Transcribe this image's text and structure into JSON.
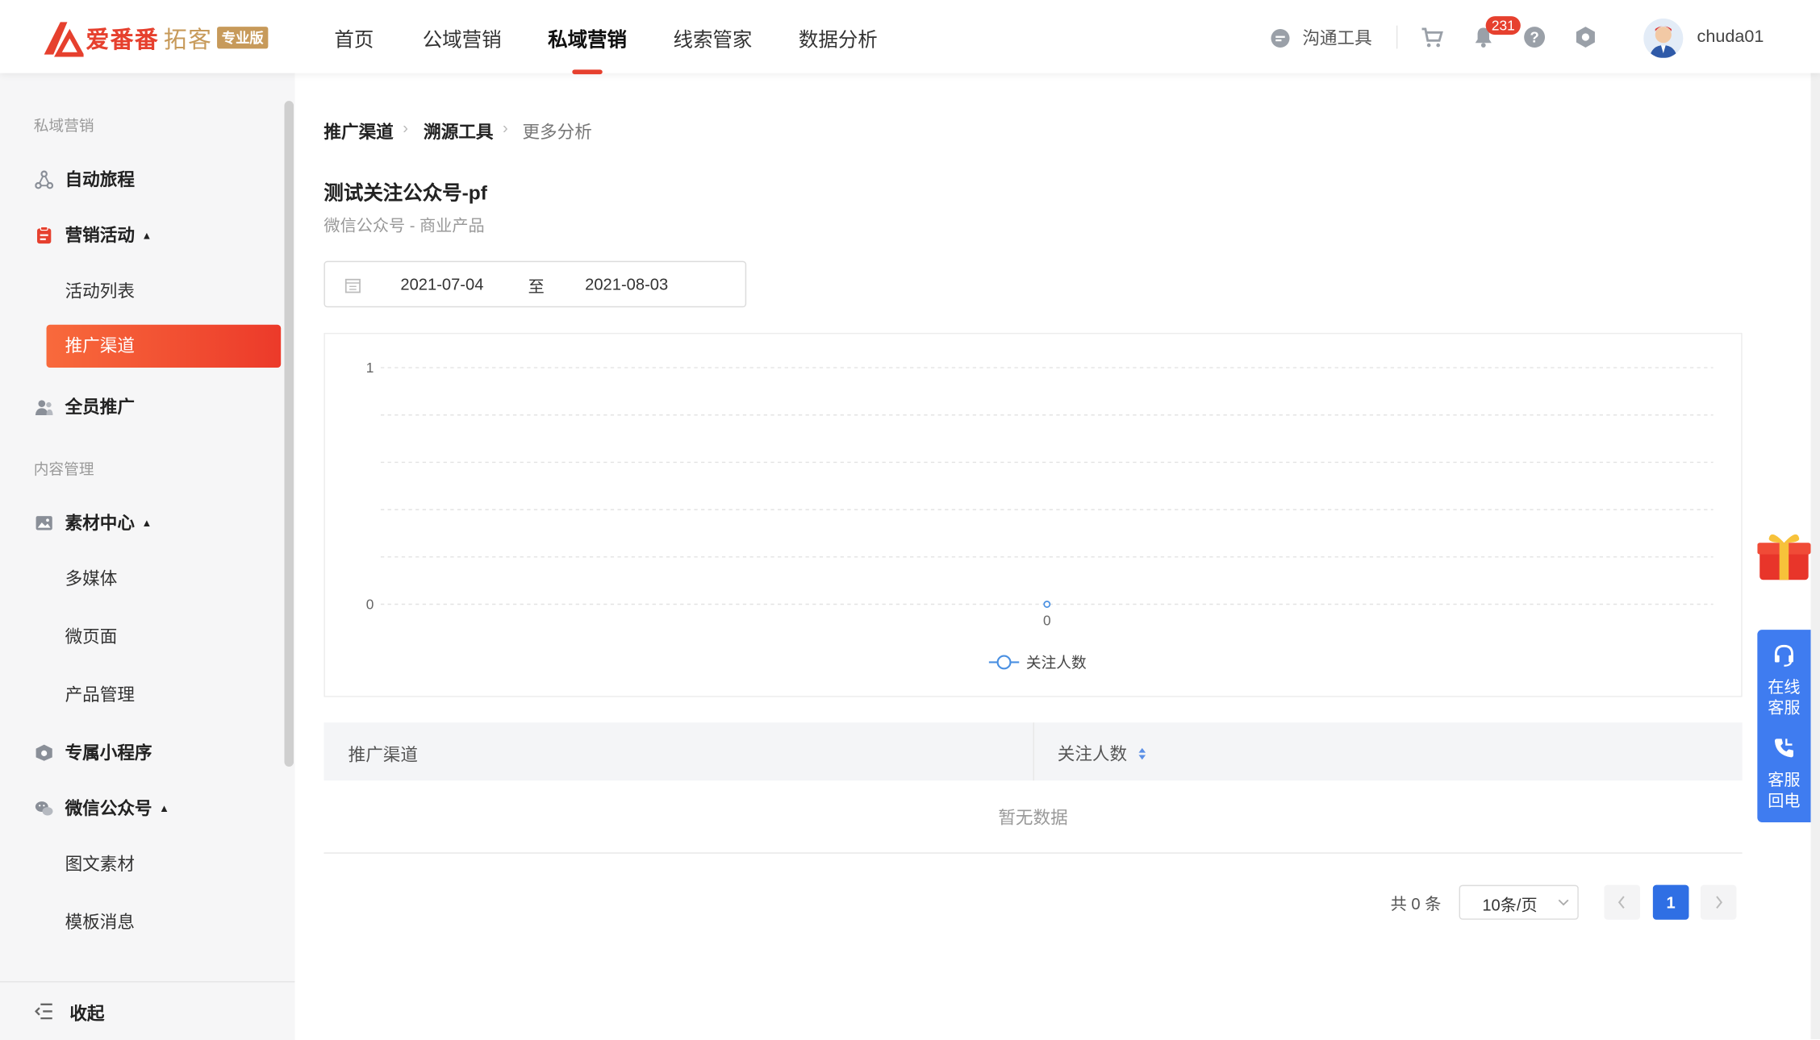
{
  "header": {
    "brand": "爱番番",
    "brand_suffix": "拓客",
    "edition": "专业版",
    "nav": [
      "首页",
      "公域营销",
      "私域营销",
      "线索管家",
      "数据分析"
    ],
    "active_nav": "私域营销",
    "comm_tool": "沟通工具",
    "notification_count": "231",
    "username": "chuda01"
  },
  "sidebar": {
    "group1": "私域营销",
    "auto_journey": "自动旅程",
    "marketing_activity": "营销活动",
    "activity_list": "活动列表",
    "promo_channel": "推广渠道",
    "all_staff_promo": "全员推广",
    "group2": "内容管理",
    "material_center": "素材中心",
    "multimedia": "多媒体",
    "micro_page": "微页面",
    "product_mgmt": "产品管理",
    "mini_program": "专属小程序",
    "wechat_oa": "微信公众号",
    "article_material": "图文素材",
    "template_msg": "模板消息",
    "collapse": "收起"
  },
  "breadcrumb": [
    "推广渠道",
    "溯源工具",
    "更多分析"
  ],
  "page": {
    "title": "测试关注公众号-pf",
    "subtitle": "微信公众号 - 商业产品",
    "date_start": "2021-07-04",
    "date_sep": "至",
    "date_end": "2021-08-03"
  },
  "chart_data": {
    "type": "line",
    "series": [
      {
        "name": "关注人数",
        "values": [
          0
        ]
      }
    ],
    "x": [
      "0"
    ],
    "ylim": [
      0,
      1
    ],
    "yticks": [
      "0",
      "1"
    ],
    "grid": true,
    "legend": "bottom-center",
    "color": "#4a90e2"
  },
  "table": {
    "columns": [
      "推广渠道",
      "关注人数"
    ],
    "empty_text": "暂无数据"
  },
  "pagination": {
    "total": "共 0 条",
    "page_size": "10条/页",
    "current_page": "1"
  },
  "float_panel": {
    "online_service": "在线客服",
    "callback": "客服回电"
  }
}
